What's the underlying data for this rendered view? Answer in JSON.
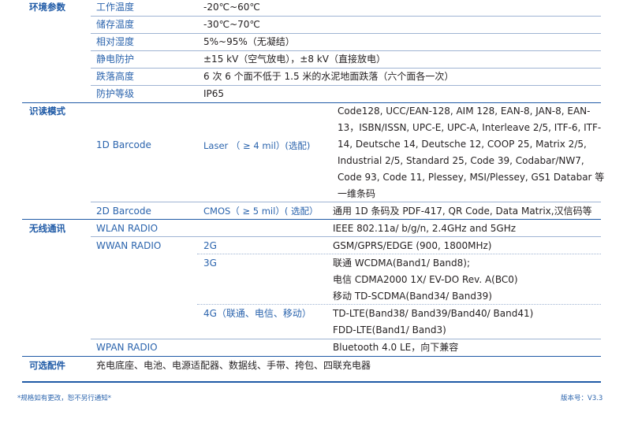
{
  "sections": {
    "env": {
      "title": "环境参数",
      "rows": [
        {
          "label": "工作温度",
          "value": "-20℃~60℃"
        },
        {
          "label": "储存温度",
          "value": "-30℃~70℃"
        },
        {
          "label": "相对湿度",
          "value": "5%~95%（无凝结）"
        },
        {
          "label": "静电防护",
          "value": "±15 kV（空气放电），±8 kV（直接放电）"
        },
        {
          "label": "跌落高度",
          "value": "6 次 6 个面不低于 1.5 米的水泥地面跌落（六个面各一次）"
        },
        {
          "label": "防护等级",
          "value": "IP65"
        }
      ]
    },
    "scan": {
      "title": "识读模式",
      "oned": {
        "label": "1D Barcode",
        "sub": "Laser  （ ≥  4 mil）(选配)",
        "lines": [
          "Code128, UCC/EAN-128, AIM 128, EAN-8, JAN-8, EAN-",
          "13，ISBN/ISSN, UPC-E, UPC-A, Interleave 2/5, ITF-6, ITF-",
          "14, Deutsche 14, Deutsche 12, COOP 25, Matrix 2/5,",
          "Industrial 2/5, Standard 25, Code 39, Codabar/NW7,",
          "Code 93, Code 11, Plessey, MSI/Plessey, GS1 Databar 等",
          "一维条码"
        ]
      },
      "twod": {
        "label": "2D Barcode",
        "sub": "CMOS（ ≥  5 mil）( 选配）",
        "value": "通用 1D 条码及 PDF-417, QR Code, Data Matrix,汉信码等"
      }
    },
    "wireless": {
      "title": "无线通讯",
      "wlan": {
        "label": "WLAN RADIO",
        "value": "IEEE 802.11a/ b/g/n, 2.4GHz and 5GHz"
      },
      "wwan": {
        "label": "WWAN RADIO",
        "g2": {
          "sub": "2G",
          "value": "GSM/GPRS/EDGE (900, 1800MHz)"
        },
        "g3": {
          "sub": "3G",
          "lines": [
            "联通 WCDMA(Band1/ Band8);",
            "电信 CDMA2000 1X/ EV-DO Rev. A(BC0)",
            "移动 TD-SCDMA(Band34/ Band39)"
          ]
        },
        "g4": {
          "sub": "4G（联通、电信、移动）",
          "lines": [
            "TD-LTE(Band38/ Band39/Band40/ Band41)",
            "FDD-LTE(Band1/ Band3)"
          ]
        }
      },
      "wpan": {
        "label": "WPAN RADIO",
        "value": "Bluetooth 4.0 LE，向下兼容"
      }
    },
    "acc": {
      "title": "可选配件",
      "value": "充电底座、电池、电源适配器、数据线、手带、挎包、四联充电器"
    }
  },
  "footer": {
    "note": "*规格如有更改，恕不另行通知*",
    "version": "版本号：V3.3"
  },
  "colors": {
    "accent": "#1f5aa6",
    "label": "#2b64ad",
    "row_fill": "#e8eef6"
  }
}
